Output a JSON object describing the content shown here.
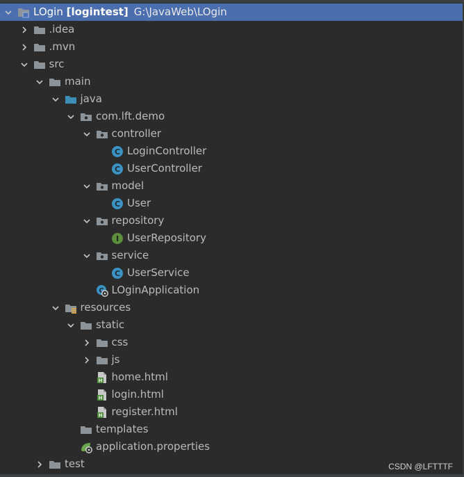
{
  "tree": [
    {
      "label": "LOgin",
      "bold_suffix": "[logintest]",
      "path": "G:\\JavaWeb\\LOgin",
      "depth": 0,
      "arrow": "down",
      "icon": "project-folder-icon",
      "selected": true
    },
    {
      "label": ".idea",
      "depth": 1,
      "arrow": "right",
      "icon": "folder-icon"
    },
    {
      "label": ".mvn",
      "depth": 1,
      "arrow": "right",
      "icon": "folder-icon"
    },
    {
      "label": "src",
      "depth": 1,
      "arrow": "down",
      "icon": "folder-icon"
    },
    {
      "label": "main",
      "depth": 2,
      "arrow": "down",
      "icon": "folder-icon"
    },
    {
      "label": "java",
      "depth": 3,
      "arrow": "down",
      "icon": "source-folder-icon"
    },
    {
      "label": "com.lft.demo",
      "depth": 4,
      "arrow": "down",
      "icon": "package-icon"
    },
    {
      "label": "controller",
      "depth": 5,
      "arrow": "down",
      "icon": "package-icon"
    },
    {
      "label": "LoginController",
      "depth": 6,
      "arrow": "none",
      "icon": "class-icon"
    },
    {
      "label": "UserController",
      "depth": 6,
      "arrow": "none",
      "icon": "class-icon"
    },
    {
      "label": "model",
      "depth": 5,
      "arrow": "down",
      "icon": "package-icon"
    },
    {
      "label": "User",
      "depth": 6,
      "arrow": "none",
      "icon": "class-icon"
    },
    {
      "label": "repository",
      "depth": 5,
      "arrow": "down",
      "icon": "package-icon"
    },
    {
      "label": "UserRepository",
      "depth": 6,
      "arrow": "none",
      "icon": "interface-icon"
    },
    {
      "label": "service",
      "depth": 5,
      "arrow": "down",
      "icon": "package-icon"
    },
    {
      "label": "UserService",
      "depth": 6,
      "arrow": "none",
      "icon": "class-icon"
    },
    {
      "label": "LOginApplication",
      "depth": 5,
      "arrow": "none",
      "icon": "spring-app-class-icon"
    },
    {
      "label": "resources",
      "depth": 3,
      "arrow": "down",
      "icon": "resources-folder-icon"
    },
    {
      "label": "static",
      "depth": 4,
      "arrow": "down",
      "icon": "folder-icon"
    },
    {
      "label": "css",
      "depth": 5,
      "arrow": "right",
      "icon": "folder-icon"
    },
    {
      "label": "js",
      "depth": 5,
      "arrow": "right",
      "icon": "folder-icon"
    },
    {
      "label": "home.html",
      "depth": 5,
      "arrow": "none",
      "icon": "html-file-icon"
    },
    {
      "label": "login.html",
      "depth": 5,
      "arrow": "none",
      "icon": "html-file-icon"
    },
    {
      "label": "register.html",
      "depth": 5,
      "arrow": "none",
      "icon": "html-file-icon"
    },
    {
      "label": "templates",
      "depth": 4,
      "arrow": "none",
      "icon": "folder-icon"
    },
    {
      "label": "application.properties",
      "depth": 4,
      "arrow": "none",
      "icon": "spring-properties-icon"
    },
    {
      "label": "test",
      "depth": 2,
      "arrow": "right",
      "icon": "folder-icon"
    }
  ],
  "watermark": "CSDN @LFTTTF",
  "colors": {
    "background": "#2b2b2b",
    "selection": "#4b6eaf",
    "text": "#bbbbbb",
    "folder": "#8c9399",
    "source_folder": "#3d8fb8",
    "class_badge": "#3a93c2",
    "interface_badge": "#5c8e3b",
    "spring_green": "#6aa84f"
  }
}
